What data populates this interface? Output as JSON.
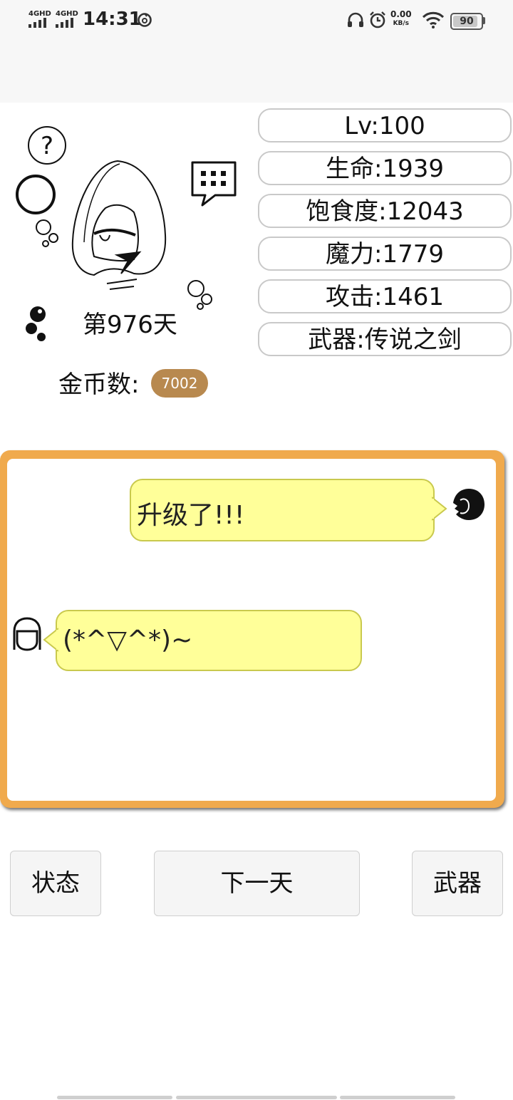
{
  "status_bar": {
    "network_1": "4GHD",
    "network_2": "4GHD",
    "time": "14:31",
    "speed_value": "0.00",
    "speed_unit": "KB/s",
    "battery": "90",
    "battery_level": 0.9
  },
  "stats": {
    "level": "Lv:100",
    "hp": "生命:1939",
    "satiety": "饱食度:12043",
    "magic": "魔力:1779",
    "attack": "攻击:1461",
    "weapon": "武器:传说之剑"
  },
  "character": {
    "day": "第976天",
    "coins_label": "金币数:",
    "coins": "7002"
  },
  "chat": {
    "messages": [
      {
        "speaker": "opponent",
        "text": "升级了!!!"
      },
      {
        "speaker": "player",
        "text": "(*^▽^*)~"
      }
    ]
  },
  "buttons": {
    "status": "状态",
    "next_day": "下一天",
    "weapon": "武器"
  },
  "colors": {
    "chat_border": "#f0aa4d",
    "bubble_fill": "#ffff99",
    "coin_badge": "#b8894f"
  }
}
